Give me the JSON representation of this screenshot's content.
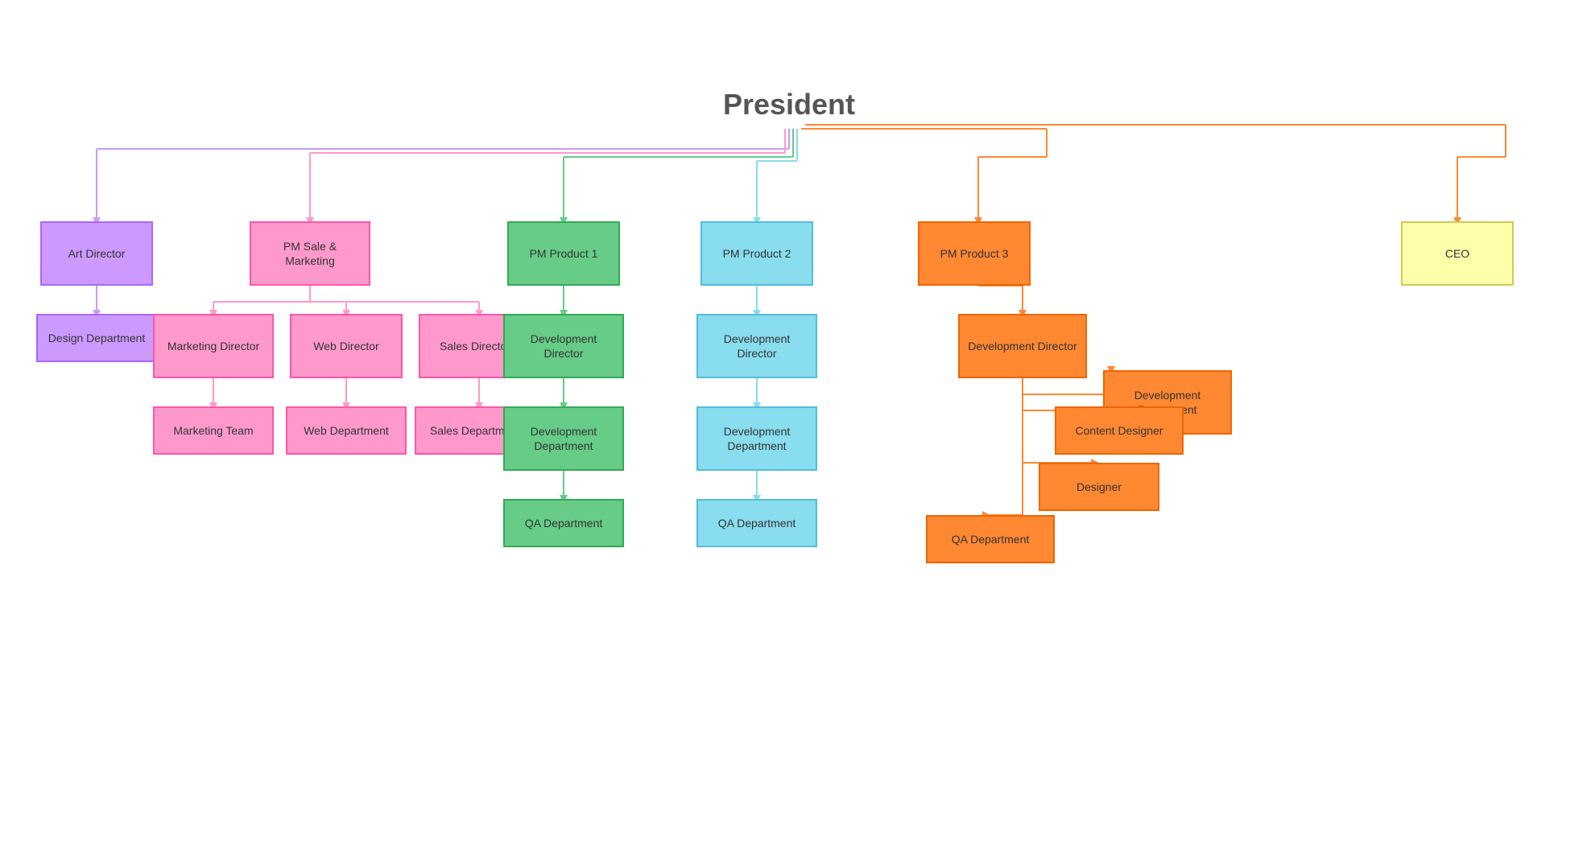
{
  "president": "President",
  "nodes": {
    "art_director": "Art Director",
    "design_dept": "Design Department",
    "pm_sale_marketing": "PM Sale & Marketing",
    "marketing_director": "Marketing Director",
    "web_director": "Web Director",
    "sales_director": "Sales Director",
    "marketing_team": "Marketing Team",
    "web_dept": "Web Department",
    "sales_dept": "Sales Department",
    "pm_product1": "PM Product 1",
    "dev_director_1": "Development Director",
    "dev_dept_1": "Development Department",
    "qa_dept_1": "QA Department",
    "pm_product2": "PM Product 2",
    "dev_director_2": "Development Director",
    "dev_dept_2": "Development Department",
    "qa_dept_2": "QA Department",
    "pm_product3": "PM Product 3",
    "dev_director_3": "Development Director",
    "dev_dept_3": "Development Department",
    "content_designer": "Content Designer",
    "designer": "Designer",
    "qa_dept_3": "QA Department",
    "ceo": "CEO"
  },
  "colors": {
    "purple": "#cc99ff",
    "purple_border": "#aa66ff",
    "pink": "#ff99cc",
    "pink_border": "#ff55aa",
    "green": "#66cc88",
    "green_border": "#33aa55",
    "lightblue": "#88ddee",
    "lightblue_border": "#55bbdd",
    "orange": "#ff8833",
    "orange_border": "#ee6600",
    "yellow": "#ffffaa",
    "yellow_border": "#cccc55"
  }
}
